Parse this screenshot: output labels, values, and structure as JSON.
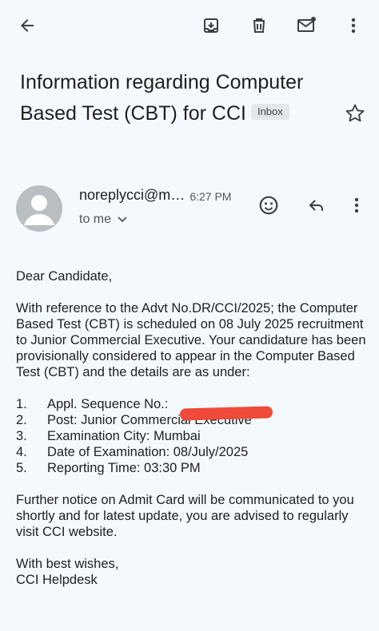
{
  "toolbar": {
    "back_icon": "arrow-back-icon",
    "archive_icon": "archive-icon",
    "delete_icon": "trash-icon",
    "mark_unread_icon": "mail-unread-icon",
    "more_icon": "more-vert-icon"
  },
  "email": {
    "subject": "Information regarding Computer Based Test (CBT) for CCI",
    "label": "Inbox",
    "sender": "noreplycci@m…",
    "time": "6:27 PM",
    "recipient": "to me",
    "body": {
      "greeting": "Dear Candidate,",
      "intro": "With reference to the Advt No.DR/CCI/2025; the Computer Based Test (CBT) is scheduled on 08 July 2025 recruitment to Junior Commercial Executive. Your candidature has been provisionally considered to appear in the Computer Based Test (CBT) and the details are as under:",
      "details": [
        {
          "num": "1.",
          "text": "Appl. Sequence No.:"
        },
        {
          "num": "2.",
          "text": "Post:  Junior Commercial Executive"
        },
        {
          "num": "3.",
          "text": "Examination City:  Mumbai"
        },
        {
          "num": "4.",
          "text": "Date of Examination: 08/July/2025"
        },
        {
          "num": "5.",
          "text": "Reporting Time: 03:30 PM"
        }
      ],
      "notice": "Further notice on Admit Card will be communicated to you shortly and for latest update, you are advised to regularly visit CCI website.",
      "closing": "With best wishes,",
      "signature": "CCI Helpdesk"
    }
  },
  "colors": {
    "background": "#f4f9fd",
    "redaction": "#ef4a3a",
    "avatar": "#b9bec3"
  }
}
